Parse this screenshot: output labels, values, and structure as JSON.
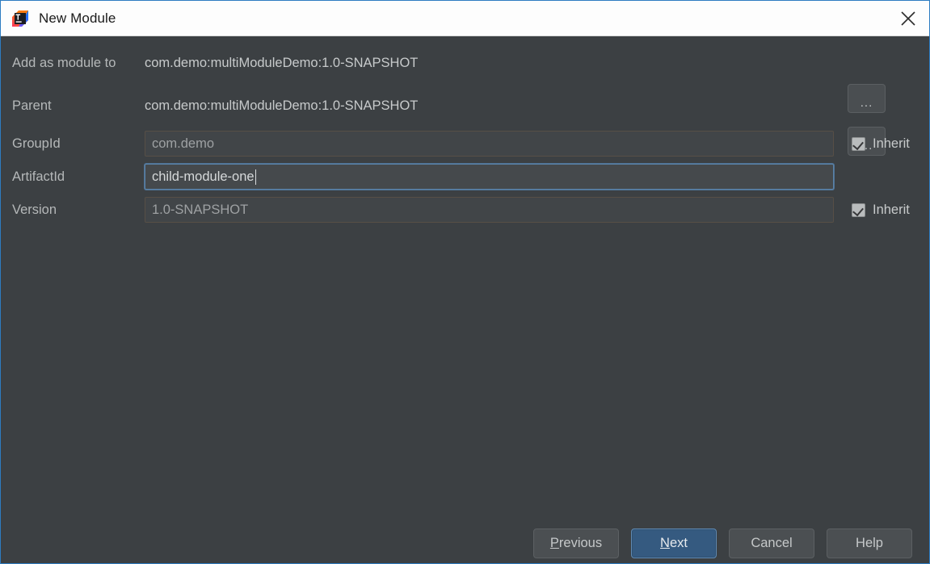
{
  "window": {
    "title": "New Module",
    "app_icon": "intellij-idea-icon",
    "close_icon": "close-icon",
    "accent_border": "#2d7cc1",
    "background": "#3c4043",
    "titlebar_background": "#fdfdfd"
  },
  "form": {
    "rows": [
      {
        "label": "Add as module to",
        "value": "com.demo:multiModuleDemo:1.0-SNAPSHOT",
        "kind": "static",
        "browse_label": "...",
        "browse_icon": "ellipsis-icon"
      },
      {
        "label": "Parent",
        "value": "com.demo:multiModuleDemo:1.0-SNAPSHOT",
        "kind": "static",
        "browse_label": "...",
        "browse_icon": "ellipsis-icon"
      },
      {
        "label": "GroupId",
        "value": "com.demo",
        "kind": "input",
        "state": "disabled",
        "inherit_label": "Inherit",
        "inherit_checked": true
      },
      {
        "label": "ArtifactId",
        "value": "child-module-one",
        "kind": "input",
        "state": "focused",
        "inherit_label": "",
        "inherit_checked": false
      },
      {
        "label": "Version",
        "value": "1.0-SNAPSHOT",
        "kind": "input",
        "state": "disabled",
        "inherit_label": "Inherit",
        "inherit_checked": true
      }
    ]
  },
  "buttons": {
    "previous": {
      "label_pre": "",
      "mnemonic": "P",
      "label_post": "revious"
    },
    "next": {
      "label_pre": "",
      "mnemonic": "N",
      "label_post": "ext",
      "primary_color": "#355a80"
    },
    "cancel": {
      "label": "Cancel"
    },
    "help": {
      "label": "Help"
    }
  }
}
